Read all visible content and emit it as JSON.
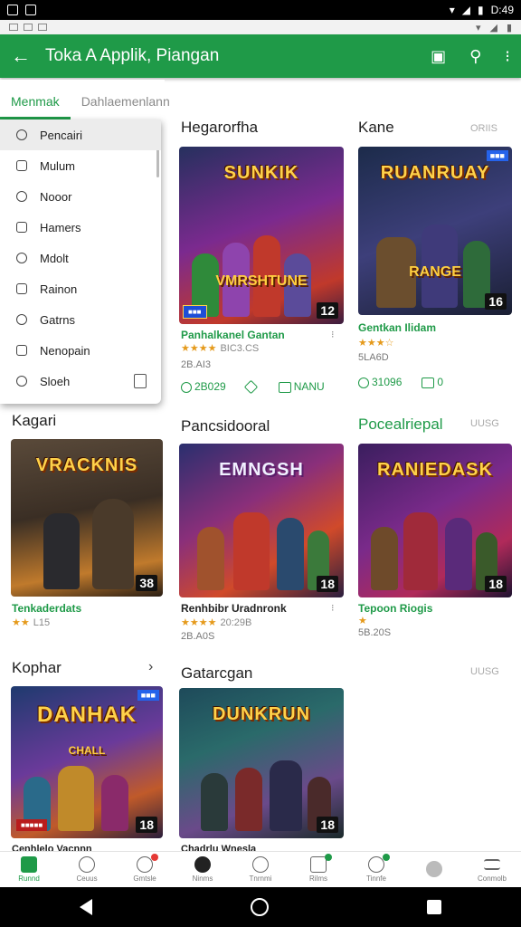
{
  "status_bar": {
    "time": "D:49"
  },
  "app_bar": {
    "title": "Toka A Applik, Piangan",
    "back_icon": "arrow-left-icon"
  },
  "tabs": [
    {
      "label": "Menmak",
      "active": true
    },
    {
      "label": "Dahlaemenlann",
      "active": false
    }
  ],
  "dropdown": {
    "items": [
      {
        "label": "Pencairi",
        "icon": "search-icon"
      },
      {
        "label": "Mulum",
        "icon": "file-icon"
      },
      {
        "label": "Nooor",
        "icon": "clock-icon"
      },
      {
        "label": "Hamers",
        "icon": "box-icon"
      },
      {
        "label": "Mdolt",
        "icon": "history-icon"
      },
      {
        "label": "Rainon",
        "icon": "folder-icon"
      },
      {
        "label": "Gatrns",
        "icon": "search-icon"
      },
      {
        "label": "Nenopain",
        "icon": "bag-icon"
      },
      {
        "label": "Sloeh",
        "icon": "link-icon"
      }
    ]
  },
  "sections": {
    "s1": {
      "title": "Hegarorfha"
    },
    "s2": {
      "title": "Kane",
      "see_more": "ORIIS"
    },
    "s3": {
      "title": "Kagari"
    },
    "s4": {
      "title": "Pancsidooral"
    },
    "s5": {
      "title": "Pocealriepal",
      "see_more": "UUSG"
    },
    "s6": {
      "title": "Kophar"
    },
    "s7": {
      "title": "Gatarcgan",
      "see_more": "UUSG"
    }
  },
  "games": {
    "g1": {
      "logo": "SUNKIK",
      "sublogo": "VMRSHTUNE",
      "age": "12",
      "badge": "",
      "name": "Panhalkanel Gantan",
      "stars": "★★★★",
      "rating": "BIC3.CS",
      "sub": "2B.AI3",
      "downloads": "2B029",
      "price": "NANU"
    },
    "g2": {
      "logo": "RUANRUAY",
      "sublogo": "RANGE",
      "age": "16",
      "badge": "",
      "name": "Gentkan Ilidam",
      "stars": "★★★☆",
      "rating": "",
      "sub": "5LA6D",
      "downloads": "31096",
      "price": "0"
    },
    "g3": {
      "logo": "VRACKNIS",
      "sublogo": "",
      "age": "38",
      "name": "Tenkaderdats",
      "stars": "★★",
      "rating": "L15",
      "sub": ""
    },
    "g4": {
      "logo": "EMNGSH",
      "sublogo": "",
      "age": "18",
      "name": "Renhbibr Uradnronk",
      "stars": "★★★★",
      "rating": "20:29B",
      "sub": "2B.A0S"
    },
    "g5": {
      "logo": "RANIEDASK",
      "sublogo": "",
      "age": "18",
      "name": "Tepoon Riogis",
      "stars": "★",
      "rating": "",
      "sub": "5B.20S"
    },
    "g6": {
      "logo": "DANHAK",
      "sublogo": "CHALL",
      "age": "18",
      "badge": "",
      "name": "Cenhlelo Vacnnn",
      "stars": ""
    },
    "g7": {
      "logo": "DUNKRUN",
      "sublogo": "",
      "age": "18",
      "name": "Chadrlu Wnesla",
      "stars": ""
    }
  },
  "bottom_nav": [
    {
      "label": "Runnd",
      "active": true
    },
    {
      "label": "Ceuus",
      "active": false
    },
    {
      "label": "Gmtsle",
      "active": false
    },
    {
      "label": "Ninms",
      "active": false
    },
    {
      "label": "Tnrnmi",
      "active": false
    },
    {
      "label": "Rilms",
      "active": false
    },
    {
      "label": "Tinnfe",
      "active": false
    },
    {
      "label": "",
      "active": false
    },
    {
      "label": "Conmolb",
      "active": false
    }
  ],
  "colors": {
    "accent": "#1f9a48",
    "rating_star": "#e59a1c"
  }
}
